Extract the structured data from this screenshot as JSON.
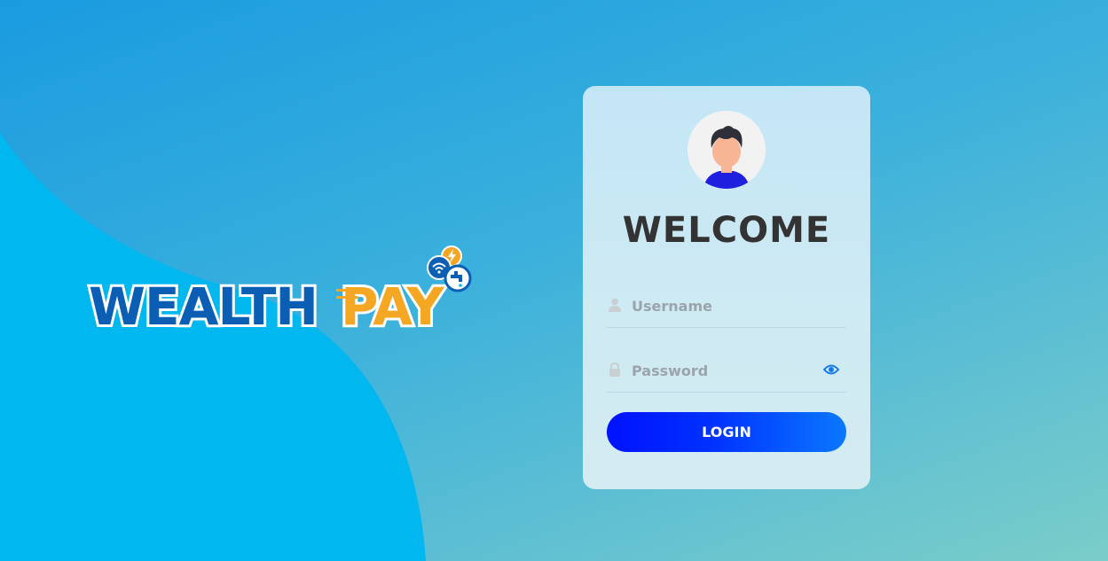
{
  "brand": {
    "logo_text_primary": "WEALTH",
    "logo_text_accent": "PAY",
    "colors": {
      "primary": "#0a5fb4",
      "accent": "#f5a623"
    }
  },
  "login": {
    "title": "WELCOME",
    "username_placeholder": "Username",
    "password_placeholder": "Password",
    "username_value": "",
    "password_value": "",
    "button_label": "LOGIN",
    "icons": {
      "avatar": "user-avatar-icon",
      "username": "user-icon",
      "password": "lock-icon",
      "toggle": "eye-icon"
    }
  },
  "theme": {
    "background_start": "#1a9be0",
    "background_end": "#7acdc8",
    "wave_color": "#00b7f0",
    "button_start": "#0011ff",
    "button_end": "#0a78ff"
  }
}
